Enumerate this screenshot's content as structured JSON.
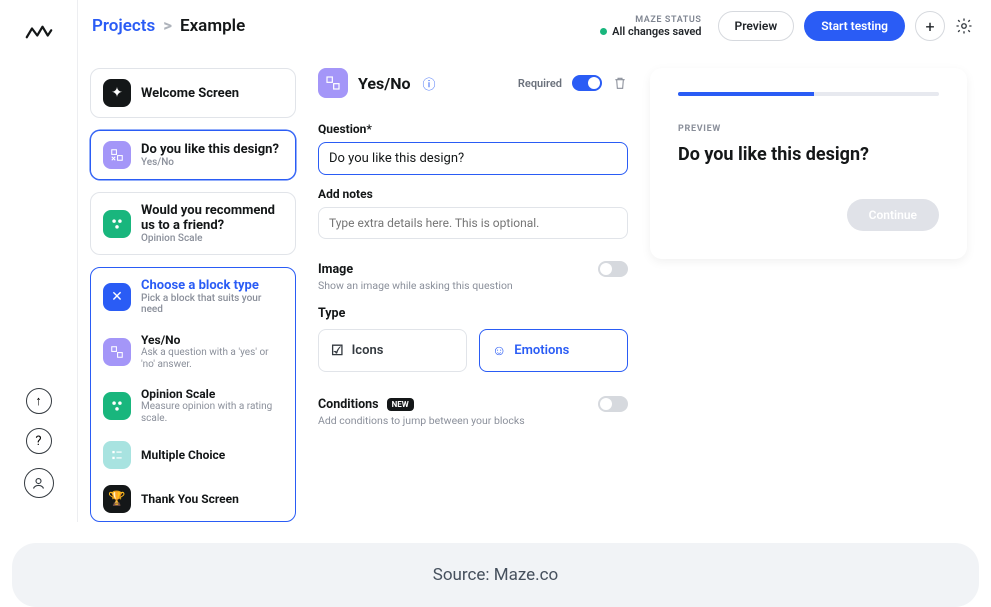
{
  "breadcrumb": {
    "projects": "Projects",
    "separator": ">",
    "current": "Example"
  },
  "status": {
    "label": "MAZE STATUS",
    "text": "All changes saved"
  },
  "buttons": {
    "preview": "Preview",
    "start_testing": "Start testing",
    "add": "+"
  },
  "blocks": {
    "welcome": {
      "title": "Welcome Screen"
    },
    "yesno": {
      "title": "Do you like this design?",
      "sub": "Yes/No"
    },
    "opinion": {
      "title": "Would you recommend us to a friend?",
      "sub": "Opinion Scale"
    }
  },
  "picker": {
    "header": {
      "title": "Choose a block type",
      "sub": "Pick a block that suits your need"
    },
    "yesno": {
      "title": "Yes/No",
      "sub": "Ask a question with a 'yes' or 'no' answer."
    },
    "opinion": {
      "title": "Opinion Scale",
      "sub": "Measure opinion with a rating scale."
    },
    "multiple": {
      "title": "Multiple Choice"
    },
    "thank": {
      "title": "Thank You Screen"
    }
  },
  "editor": {
    "title": "Yes/No",
    "required_label": "Required",
    "question_label": "Question*",
    "question_value": "Do you like this design?",
    "notes_label": "Add notes",
    "notes_placeholder": "Type extra details here. This is optional.",
    "image": {
      "title": "Image",
      "sub": "Show an image while asking this question"
    },
    "type_label": "Type",
    "type_icons": "Icons",
    "type_emotions": "Emotions",
    "conditions": {
      "title": "Conditions",
      "badge": "NEW",
      "sub": "Add conditions to jump between your blocks"
    }
  },
  "preview": {
    "label": "PREVIEW",
    "question": "Do you like this design?",
    "continue": "Continue"
  },
  "source": "Source: Maze.co"
}
